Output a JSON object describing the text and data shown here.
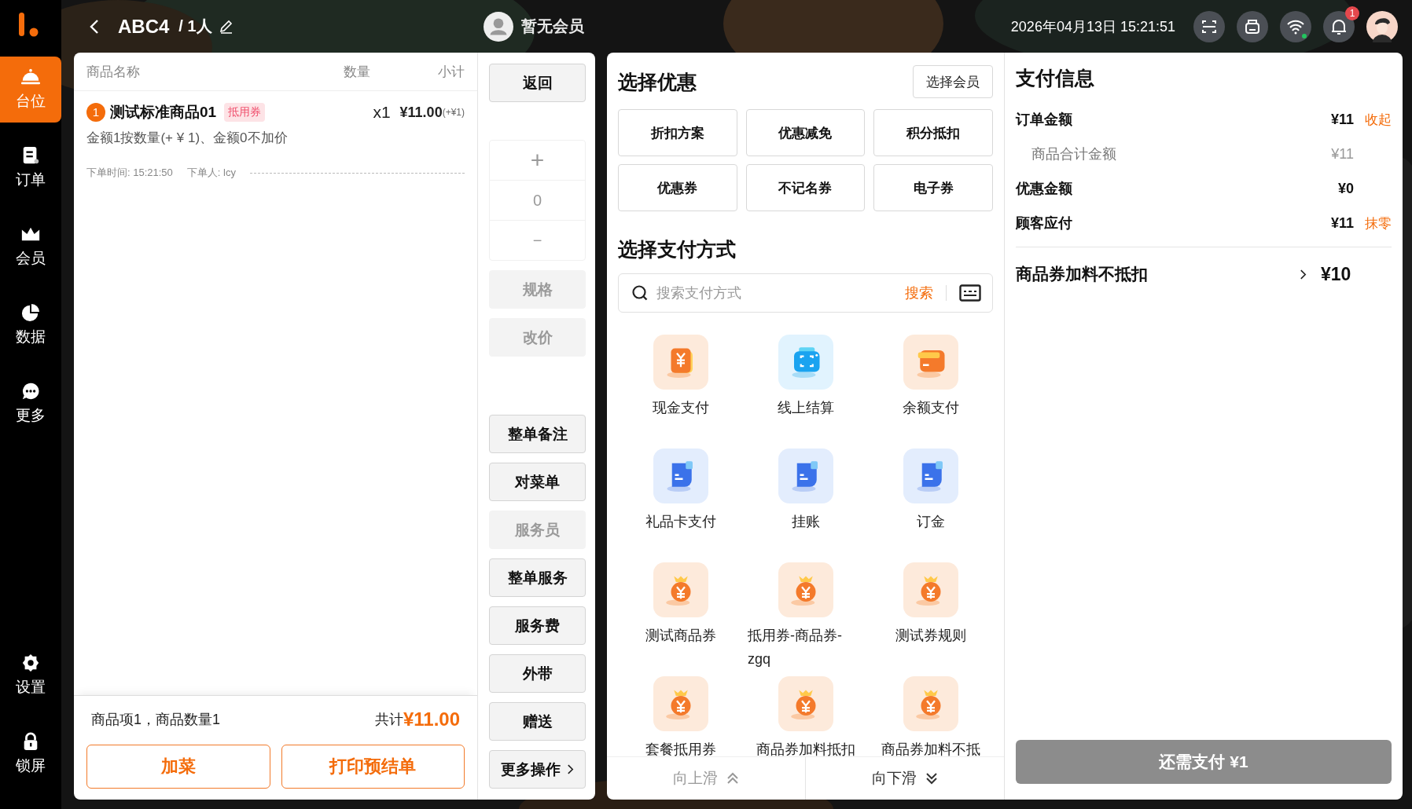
{
  "sidebar": {
    "items": [
      {
        "label": "台位",
        "kind": "table",
        "selected": true
      },
      {
        "label": "订单",
        "kind": "order",
        "selected": false
      },
      {
        "label": "会员",
        "kind": "member",
        "selected": false
      },
      {
        "label": "数据",
        "kind": "data",
        "selected": false
      },
      {
        "label": "更多",
        "kind": "more",
        "selected": false
      }
    ],
    "bottom_items": [
      {
        "label": "设置",
        "kind": "settings",
        "selected": false
      },
      {
        "label": "锁屏",
        "kind": "lock",
        "selected": false
      }
    ]
  },
  "header": {
    "table": "ABC4",
    "guests": "/ 1人",
    "member": "暂无会员",
    "datetime": "2026年04月13日 15:21:51",
    "notification_count": "1"
  },
  "order": {
    "columns": [
      "商品名称",
      "数量",
      "小计"
    ],
    "items": [
      {
        "index": "1",
        "name": "测试标准商品01",
        "tag": "抵用券",
        "quantity": "x1",
        "price": "¥11.00",
        "extra": "(+¥1)",
        "note": "金额1按数量(+ ¥ 1)、金额0不加价",
        "time": "下单时间: 15:21:50",
        "orderer": "下单人: lcy"
      }
    ],
    "summary": "商品项1，商品数量1",
    "total_label": "共计",
    "total": "¥11.00",
    "buttons": [
      "加菜",
      "打印预结单"
    ]
  },
  "actions": {
    "top": [
      {
        "label": "返回",
        "kind": "button",
        "disabled": false
      }
    ],
    "stepper": {
      "plus": "+",
      "value": "0",
      "minus": "−",
      "disabled": true
    },
    "middle": [
      {
        "label": "规格",
        "kind": "button",
        "disabled": true
      },
      {
        "label": "改价",
        "kind": "button",
        "disabled": true
      }
    ],
    "bottom": [
      {
        "label": "整单备注",
        "kind": "button",
        "disabled": false
      },
      {
        "label": "对菜单",
        "kind": "button",
        "disabled": false
      },
      {
        "label": "服务员",
        "kind": "button",
        "disabled": true
      },
      {
        "label": "整单服务",
        "kind": "button",
        "disabled": false
      },
      {
        "label": "服务费",
        "kind": "button",
        "disabled": false
      },
      {
        "label": "外带",
        "kind": "button",
        "disabled": false
      },
      {
        "label": "赠送",
        "kind": "button",
        "disabled": false
      },
      {
        "label": "更多操作",
        "kind": "menu",
        "disabled": false
      }
    ]
  },
  "discounts": {
    "title": "选择优惠",
    "member_button": "选择会员",
    "options": [
      "折扣方案",
      "优惠减免",
      "积分抵扣",
      "优惠券",
      "不记名券",
      "电子券"
    ]
  },
  "payment": {
    "title": "选择支付方式",
    "search": {
      "placeholder": "搜索支付方式",
      "button": "搜索"
    },
    "methods": [
      {
        "label": "现金支付",
        "kind": "cash"
      },
      {
        "label": "线上结算",
        "kind": "online"
      },
      {
        "label": "余额支付",
        "kind": "balance"
      },
      {
        "label": "礼品卡支付",
        "kind": "card"
      },
      {
        "label": "挂账",
        "kind": "card"
      },
      {
        "label": "订金",
        "kind": "card"
      },
      {
        "label": "测试商品券",
        "kind": "bag"
      },
      {
        "label": "抵用券-商品券-zgq",
        "kind": "bag"
      },
      {
        "label": "测试券规则",
        "kind": "bag"
      },
      {
        "label": "套餐抵用券",
        "kind": "bag"
      },
      {
        "label": "商品券加料抵扣",
        "kind": "bag"
      },
      {
        "label": "商品券加料不抵",
        "kind": "bag"
      }
    ],
    "scroll_up": {
      "label": "向上滑",
      "disabled": true
    },
    "scroll_down": {
      "label": "向下滑",
      "disabled": false
    }
  },
  "payment_info": {
    "title": "支付信息",
    "rows": [
      {
        "label": "订单金额",
        "value": "¥11",
        "action": "收起",
        "kind": "main"
      },
      {
        "label": "商品合计金额",
        "value": "¥11",
        "kind": "sub"
      },
      {
        "label": "优惠金额",
        "value": "¥0",
        "kind": "main"
      },
      {
        "label": "顾客应付",
        "value": "¥11",
        "action": "抹零",
        "kind": "main"
      }
    ],
    "voucher": {
      "label": "商品券加料不抵扣",
      "value": "¥10"
    },
    "pay_button": "还需支付 ¥1"
  }
}
